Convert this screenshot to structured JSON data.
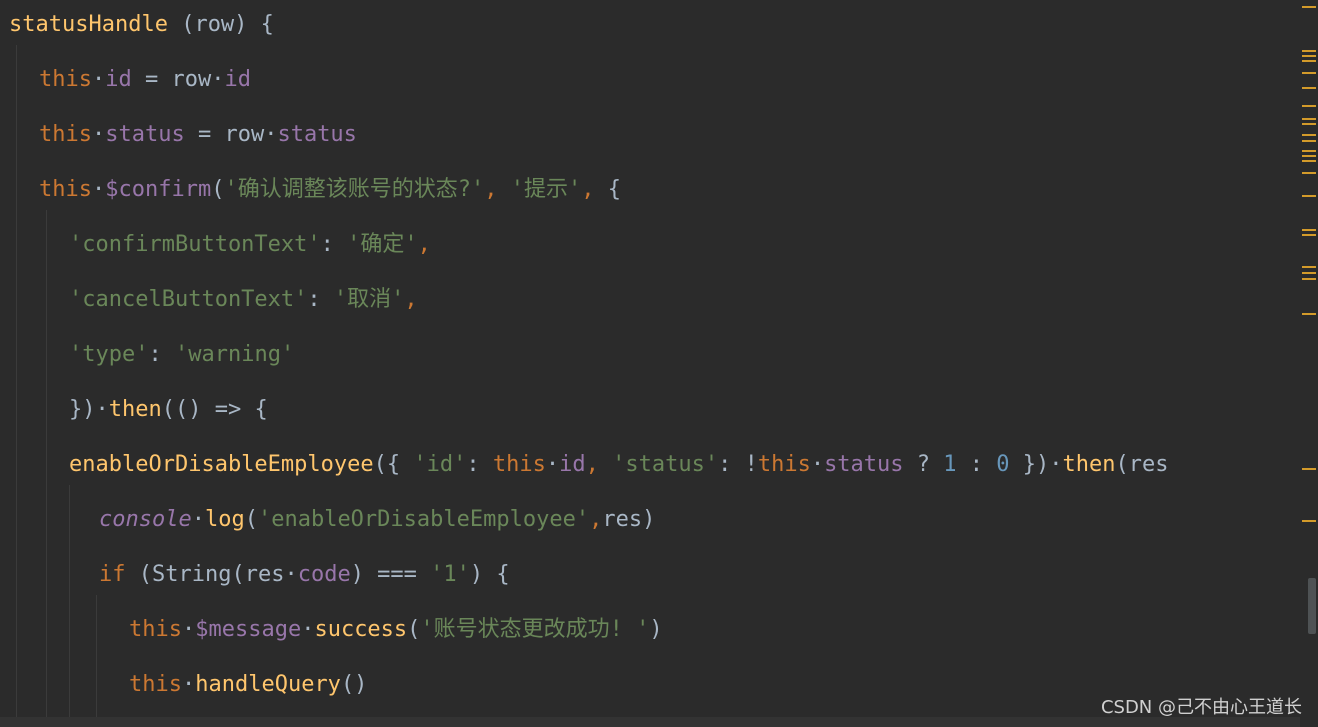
{
  "editor": {
    "lines": [
      [
        {
          "t": "statusHandle",
          "c": "c-method"
        },
        {
          "t": " (row) {",
          "c": "c-plain"
        }
      ],
      [
        {
          "t": "this",
          "c": "c-kw"
        },
        {
          "t": "·",
          "c": "c-plain"
        },
        {
          "t": "id",
          "c": "c-prop"
        },
        {
          "t": " = row",
          "c": "c-plain"
        },
        {
          "t": "·",
          "c": "c-plain"
        },
        {
          "t": "id",
          "c": "c-prop"
        }
      ],
      [
        {
          "t": "this",
          "c": "c-kw"
        },
        {
          "t": "·",
          "c": "c-plain"
        },
        {
          "t": "status",
          "c": "c-prop"
        },
        {
          "t": " = row",
          "c": "c-plain"
        },
        {
          "t": "·",
          "c": "c-plain"
        },
        {
          "t": "status",
          "c": "c-prop"
        }
      ],
      [
        {
          "t": "this",
          "c": "c-kw"
        },
        {
          "t": "·",
          "c": "c-plain"
        },
        {
          "t": "$confirm",
          "c": "c-prop"
        },
        {
          "t": "(",
          "c": "c-plain"
        },
        {
          "t": "'确认调整该账号的状态?'",
          "c": "c-str"
        },
        {
          "t": ", ",
          "c": "c-punc"
        },
        {
          "t": "'提示'",
          "c": "c-str"
        },
        {
          "t": ", ",
          "c": "c-punc"
        },
        {
          "t": "{",
          "c": "c-plain"
        }
      ],
      [
        {
          "t": "'confirmButtonText'",
          "c": "c-str"
        },
        {
          "t": ": ",
          "c": "c-plain"
        },
        {
          "t": "'确定'",
          "c": "c-str"
        },
        {
          "t": ",",
          "c": "c-punc"
        }
      ],
      [
        {
          "t": "'cancelButtonText'",
          "c": "c-str"
        },
        {
          "t": ": ",
          "c": "c-plain"
        },
        {
          "t": "'取消'",
          "c": "c-str"
        },
        {
          "t": ",",
          "c": "c-punc"
        }
      ],
      [
        {
          "t": "'type'",
          "c": "c-str"
        },
        {
          "t": ": ",
          "c": "c-plain"
        },
        {
          "t": "'warning'",
          "c": "c-str"
        }
      ],
      [
        {
          "t": "})",
          "c": "c-plain"
        },
        {
          "t": "·",
          "c": "c-plain"
        },
        {
          "t": "then",
          "c": "c-method"
        },
        {
          "t": "(() => {",
          "c": "c-plain"
        }
      ],
      [
        {
          "t": "enableOrDisableEmployee",
          "c": "c-method"
        },
        {
          "t": "({ ",
          "c": "c-plain"
        },
        {
          "t": "'id'",
          "c": "c-str"
        },
        {
          "t": ": ",
          "c": "c-plain"
        },
        {
          "t": "this",
          "c": "c-kw"
        },
        {
          "t": "·",
          "c": "c-plain"
        },
        {
          "t": "id",
          "c": "c-prop"
        },
        {
          "t": ", ",
          "c": "c-punc"
        },
        {
          "t": "'status'",
          "c": "c-str"
        },
        {
          "t": ": !",
          "c": "c-plain"
        },
        {
          "t": "this",
          "c": "c-kw"
        },
        {
          "t": "·",
          "c": "c-plain"
        },
        {
          "t": "status",
          "c": "c-prop"
        },
        {
          "t": " ? ",
          "c": "c-plain"
        },
        {
          "t": "1",
          "c": "c-num"
        },
        {
          "t": " : ",
          "c": "c-plain"
        },
        {
          "t": "0",
          "c": "c-num"
        },
        {
          "t": " })",
          "c": "c-plain"
        },
        {
          "t": "·",
          "c": "c-plain"
        },
        {
          "t": "then",
          "c": "c-method"
        },
        {
          "t": "(res",
          "c": "c-plain"
        }
      ],
      [
        {
          "t": "console",
          "c": "c-italic"
        },
        {
          "t": "·",
          "c": "c-plain"
        },
        {
          "t": "log",
          "c": "c-method"
        },
        {
          "t": "(",
          "c": "c-plain"
        },
        {
          "t": "'enableOrDisableEmployee'",
          "c": "c-str"
        },
        {
          "t": ",",
          "c": "c-punc"
        },
        {
          "t": "res)",
          "c": "c-plain"
        }
      ],
      [
        {
          "t": "if",
          "c": "c-kw"
        },
        {
          "t": " (String(res",
          "c": "c-plain"
        },
        {
          "t": "·",
          "c": "c-plain"
        },
        {
          "t": "code",
          "c": "c-prop"
        },
        {
          "t": ") === ",
          "c": "c-plain"
        },
        {
          "t": "'1'",
          "c": "c-str"
        },
        {
          "t": ") {",
          "c": "c-plain"
        }
      ],
      [
        {
          "t": "this",
          "c": "c-kw"
        },
        {
          "t": "·",
          "c": "c-plain"
        },
        {
          "t": "$message",
          "c": "c-prop"
        },
        {
          "t": "·",
          "c": "c-plain"
        },
        {
          "t": "success",
          "c": "c-method"
        },
        {
          "t": "(",
          "c": "c-plain"
        },
        {
          "t": "'账号状态更改成功! '",
          "c": "c-str"
        },
        {
          "t": ")",
          "c": "c-plain"
        }
      ],
      [
        {
          "t": "this",
          "c": "c-kw"
        },
        {
          "t": "·",
          "c": "c-plain"
        },
        {
          "t": "handleQuery",
          "c": "c-method"
        },
        {
          "t": "()",
          "c": "c-plain"
        }
      ]
    ]
  },
  "watermark": "CSDN @己不由心王道长",
  "colors": {
    "background": "#2b2b2b",
    "method": "#ffc66d",
    "keyword": "#cc7832",
    "property": "#9876aa",
    "string": "#6a8759",
    "number": "#6897bb",
    "plain": "#a9b7c6",
    "gutter_mark": "#d49b2a"
  }
}
